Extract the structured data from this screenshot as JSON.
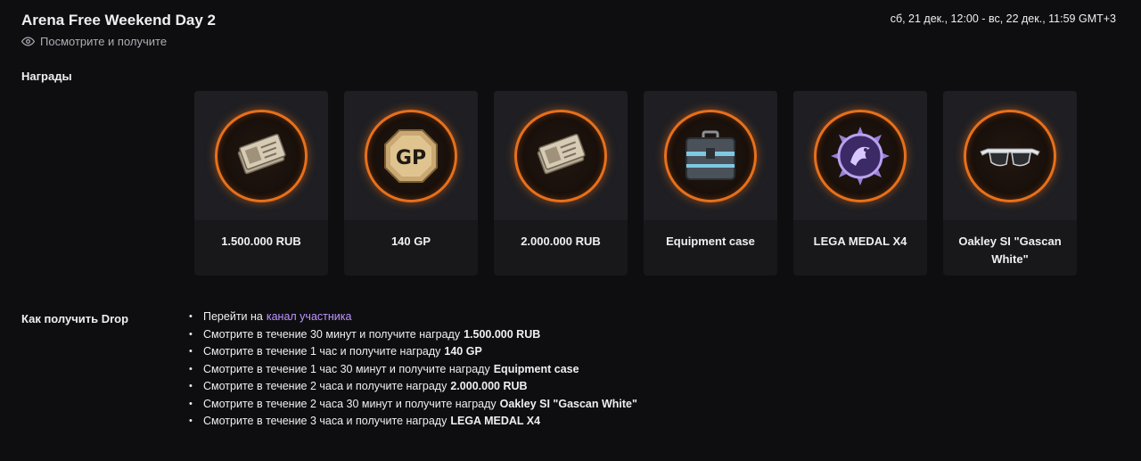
{
  "header": {
    "title": "Arena Free Weekend Day 2",
    "subtitle": "Посмотрите и получите",
    "date_range": "сб, 21 дек., 12:00 - вс, 22 дек., 11:59 GMT+3"
  },
  "rewards_section": {
    "label": "Награды",
    "items": [
      {
        "name": "1.500.000 RUB",
        "icon": "money-icon"
      },
      {
        "name": "140 GP",
        "icon": "gp-coin-icon"
      },
      {
        "name": "2.000.000 RUB",
        "icon": "money-icon"
      },
      {
        "name": "Equipment case",
        "icon": "equipment-case-icon"
      },
      {
        "name": "LEGA MEDAL X4",
        "icon": "medal-icon"
      },
      {
        "name": "Oakley SI \"Gascan White\"",
        "icon": "sunglasses-icon"
      }
    ]
  },
  "howto_section": {
    "label": "Как получить Drop",
    "first_item_text": "Перейти на",
    "first_item_link": "канал участника",
    "items": [
      {
        "text": "Смотрите в течение 30 минут и получите награду",
        "reward": "1.500.000 RUB"
      },
      {
        "text": "Смотрите в течение 1 час и получите награду",
        "reward": "140 GP"
      },
      {
        "text": "Смотрите в течение 1 час 30 минут и получите награду",
        "reward": "Equipment case"
      },
      {
        "text": "Смотрите в течение 2 часа и получите награду",
        "reward": "2.000.000 RUB"
      },
      {
        "text": "Смотрите в течение 2 часа 30 минут и получите награду",
        "reward": "Oakley SI \"Gascan White\""
      },
      {
        "text": "Смотрите в течение 3 часа и получите награду",
        "reward": "LEGA MEDAL X4"
      }
    ]
  },
  "colors": {
    "background": "#0e0e10",
    "card": "#18181b",
    "ring_accent": "#e8701a",
    "link": "#bf94ff"
  }
}
